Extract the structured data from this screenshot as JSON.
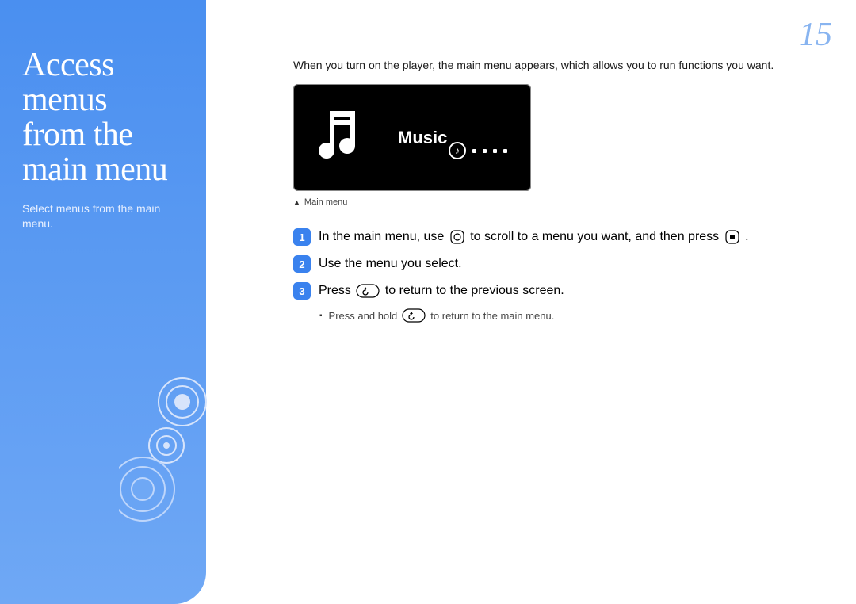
{
  "page_number": "15",
  "sidebar": {
    "title_line1": "Access menus",
    "title_line2": "from the",
    "title_line3": "main menu",
    "subtitle": "Select menus from the main menu."
  },
  "intro": "When you turn on the player, the main menu appears, which allows you to run functions you want.",
  "screenshot": {
    "label": "Music",
    "caption": "Main menu"
  },
  "steps": {
    "s1_a": "In the main menu, use",
    "s1_b": "to scroll to a menu you want, and then press",
    "s1_c": ".",
    "s2": "Use the menu you select.",
    "s3_a": "Press",
    "s3_b": "to return to the previous screen.",
    "s3_sub_a": "Press and hold",
    "s3_sub_b": "to return to the main menu."
  }
}
